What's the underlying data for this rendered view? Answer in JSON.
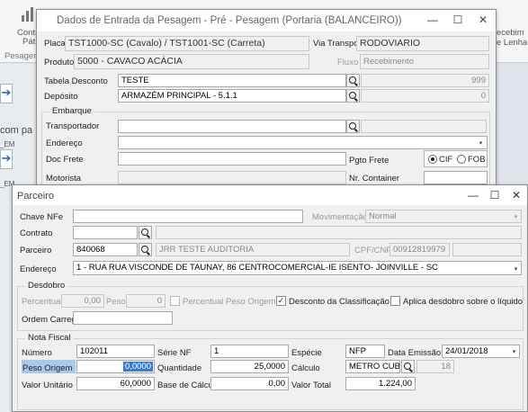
{
  "bg": {
    "app_icon": "chart-icon",
    "ribbon_left1": "Contr",
    "ribbon_left2": "Pát",
    "ribbon_left3": "Pesagen",
    "ribbon_right1": "ecebim",
    "ribbon_right2": "e Lenha",
    "com_pa": "com pa",
    "em1": "_EM",
    "em2": "_EM"
  },
  "w1": {
    "title": "Dados de Entrada da Pesagem - Pré - Pesagem (Portaria (BALANCEIRO))",
    "btn_min": "—",
    "btn_max": "☐",
    "btn_close": "✕",
    "placa_lbl": "Placa",
    "placa_val": "TST1000-SC (Cavalo) / TST1001-SC (Carreta)",
    "via_lbl": "Via Transporte",
    "via_val": "RODOVIARIO",
    "produto_lbl": "Produto",
    "produto_val": "5000 - CAVACO ACÁCIA",
    "fluxo_lbl": "Fluxo",
    "fluxo_val": "Recebimento",
    "tabela_lbl": "Tabela Desconto",
    "tabela_val": "TESTE",
    "tabela_num": "999",
    "deposito_lbl": "Depósito",
    "deposito_val": "ARMAZÉM PRINCIPAL - 5.1.1",
    "deposito_num": "0",
    "embarque": "Embarque",
    "transp_lbl": "Transportador",
    "endereco_lbl": "Endereço",
    "docfrete_lbl": "Doc Frete",
    "pgto_lbl": "Pgto Frete",
    "cif": "CIF",
    "fob": "FOB",
    "motorista_lbl": "Motorista",
    "nrcont_lbl": "Nr. Container"
  },
  "w2": {
    "title": "Parceiro",
    "btn_min": "—",
    "btn_max": "☐",
    "btn_close": "✕",
    "chave_lbl": "Chave NFe",
    "mov_lbl": "Movimentação",
    "mov_val": "Normal",
    "contrato_lbl": "Contrato",
    "parceiro_lbl": "Parceiro",
    "parceiro_code": "840068",
    "parceiro_name": "JRR TESTE AUDITORIA",
    "cpf_lbl": "CPF/CNPJ",
    "cpf_val": "00912819979",
    "endereco_lbl": "Endereço",
    "endereco_val": "1 - RUA RUA VISCONDE DE TAUNAY, 86  CENTROCOMERCIAL-IE ISENTO- JOINVILLE - SC",
    "desdobro": "Desdobro",
    "percentual_lbl": "Percentual",
    "percentual_val": "0,00",
    "peso_lbl": "Peso",
    "peso_val": "0",
    "perc_peso_origem": "Percentual Peso Origem",
    "desc_class": "Desconto da Classificação",
    "aplica": "Aplica desdobro sobre o líquido",
    "ordem_lbl": "Ordem Carreg.",
    "nota": "Nota Fiscal",
    "numero_lbl": "Número",
    "numero_val": "102011",
    "serie_lbl": "Série NF",
    "serie_val": "1",
    "especie_lbl": "Espécie",
    "especie_val": "NFP",
    "emissao_lbl": "Data Emissão",
    "emissao_val": "24/01/2018",
    "pesoorig_lbl": "Peso Origem",
    "pesoorig_val": "0,0000",
    "qtd_lbl": "Quantidade",
    "qtd_val": "25,0000",
    "calc_lbl": "Cálculo",
    "calc_val": "METRO CUBICO",
    "calc_num": "18",
    "vunit_lbl": "Valor Unitário",
    "vunit_val": "60,0000",
    "base_lbl": "Base de Cálculo",
    "base_val": "0,00",
    "vtotal_lbl": "Valor Total",
    "vtotal_val": "1.224,00"
  }
}
